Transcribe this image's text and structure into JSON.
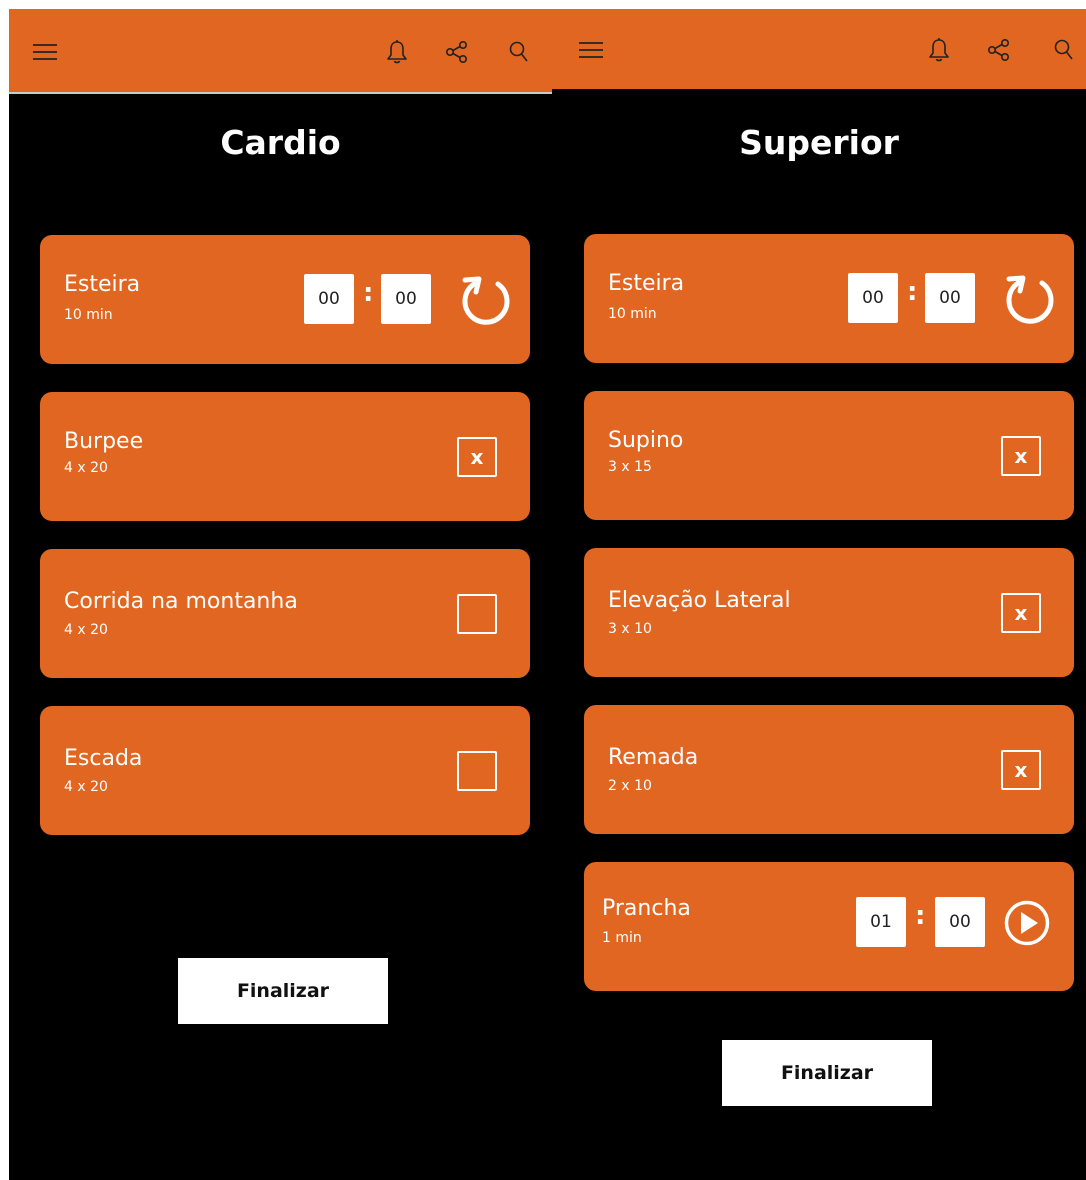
{
  "screens": [
    {
      "title": "Cardio",
      "exercises": [
        {
          "name": "Esteira",
          "detail": "10 min",
          "timer_min": "00",
          "timer_sec": "00",
          "control": "restart-icon"
        },
        {
          "name": "Burpee",
          "detail": "4 x 20",
          "checked": true,
          "mark": "x"
        },
        {
          "name": "Corrida na montanha",
          "detail": "4 x 20",
          "checked": false,
          "mark": ""
        },
        {
          "name": "Escada",
          "detail": "4 x 20",
          "checked": false,
          "mark": ""
        }
      ],
      "finish_label": "Finalizar"
    },
    {
      "title": "Superior",
      "exercises": [
        {
          "name": "Esteira",
          "detail": "10 min",
          "timer_min": "00",
          "timer_sec": "00",
          "control": "restart-icon"
        },
        {
          "name": "Supino",
          "detail": "3 x 15",
          "checked": true,
          "mark": "x"
        },
        {
          "name": "Elevação Lateral",
          "detail": "3 x 10",
          "checked": true,
          "mark": "x"
        },
        {
          "name": "Remada",
          "detail": "2 x 10",
          "checked": true,
          "mark": "x"
        },
        {
          "name": "Prancha",
          "detail": "1 min",
          "timer_min": "01",
          "timer_sec": "00",
          "control": "play-icon"
        }
      ],
      "finish_label": "Finalizar"
    }
  ],
  "timer_separator": ":",
  "icons": {
    "menu": "menu-icon",
    "notifications": "bell-icon",
    "share": "share-icon",
    "search": "search-icon"
  },
  "colors": {
    "accent": "#E06622",
    "background": "#000000",
    "text": "#FFFFFF",
    "button_bg": "#FFFFFF"
  }
}
